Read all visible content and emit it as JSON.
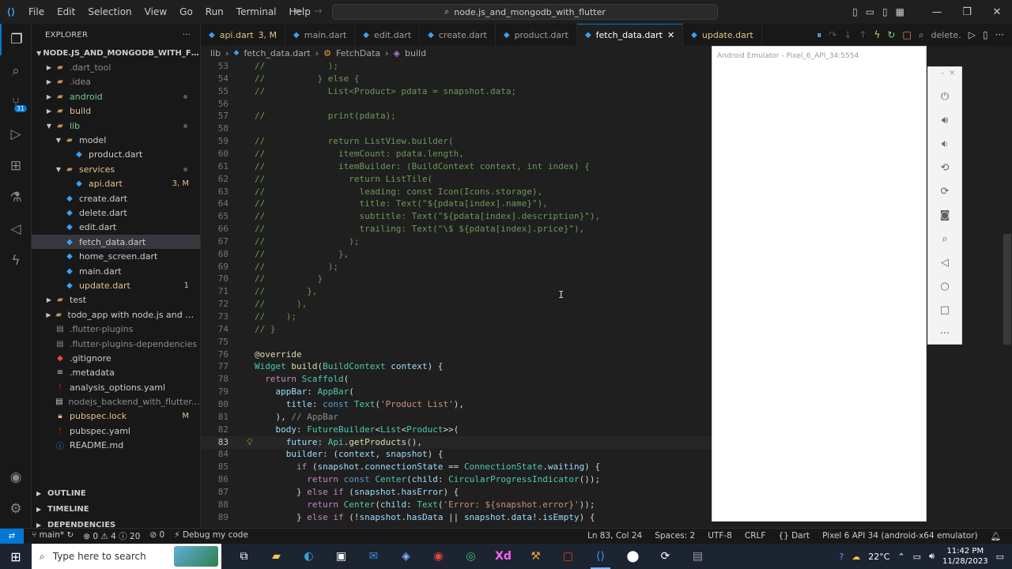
{
  "titlebar": {
    "menu": [
      "File",
      "Edit",
      "Selection",
      "View",
      "Go",
      "Run",
      "Terminal",
      "Help"
    ],
    "search": "node.js_and_mongodb_with_flutter"
  },
  "activity": {
    "source_control_badge": "31"
  },
  "sidebar": {
    "title": "EXPLORER",
    "root": "NODE.JS_AND_MONGODB_WITH_FLUTTER",
    "items": [
      {
        "label": ".dart_tool",
        "indent": 1,
        "kind": "folder",
        "open": false,
        "color": "#8b8b8b"
      },
      {
        "label": ".idea",
        "indent": 1,
        "kind": "folder",
        "open": false,
        "color": "#8b8b8b"
      },
      {
        "label": "android",
        "indent": 1,
        "kind": "folder",
        "open": false,
        "color": "#73c991",
        "dot": true
      },
      {
        "label": "build",
        "indent": 1,
        "kind": "folder",
        "open": false,
        "color": "#e2c08d"
      },
      {
        "label": "lib",
        "indent": 1,
        "kind": "folder",
        "open": true,
        "color": "#73c991",
        "dot": true
      },
      {
        "label": "model",
        "indent": 2,
        "kind": "folder",
        "open": true,
        "color": "#cccccc"
      },
      {
        "label": "product.dart",
        "indent": 3,
        "kind": "dart",
        "color": "#cccccc"
      },
      {
        "label": "services",
        "indent": 2,
        "kind": "folder",
        "open": true,
        "color": "#e2c08d",
        "dot": true
      },
      {
        "label": "api.dart",
        "indent": 3,
        "kind": "dart",
        "color": "#e2c08d",
        "badge": "3, M"
      },
      {
        "label": "create.dart",
        "indent": 2,
        "kind": "dart",
        "color": "#cccccc"
      },
      {
        "label": "delete.dart",
        "indent": 2,
        "kind": "dart",
        "color": "#cccccc"
      },
      {
        "label": "edit.dart",
        "indent": 2,
        "kind": "dart",
        "color": "#cccccc"
      },
      {
        "label": "fetch_data.dart",
        "indent": 2,
        "kind": "dart",
        "color": "#cccccc",
        "selected": true
      },
      {
        "label": "home_screen.dart",
        "indent": 2,
        "kind": "dart",
        "color": "#cccccc"
      },
      {
        "label": "main.dart",
        "indent": 2,
        "kind": "dart",
        "color": "#cccccc"
      },
      {
        "label": "update.dart",
        "indent": 2,
        "kind": "dart",
        "color": "#e2c08d",
        "badge": "1"
      },
      {
        "label": "test",
        "indent": 1,
        "kind": "folder",
        "open": false,
        "color": "#cccccc"
      },
      {
        "label": "todo_app with node.js and mon...",
        "indent": 1,
        "kind": "folder",
        "open": false,
        "color": "#cccccc"
      },
      {
        "label": ".flutter-plugins",
        "indent": 1,
        "kind": "file",
        "color": "#8b8b8b"
      },
      {
        "label": ".flutter-plugins-dependencies",
        "indent": 1,
        "kind": "file",
        "color": "#8b8b8b"
      },
      {
        "label": ".gitignore",
        "indent": 1,
        "kind": "git",
        "color": "#cccccc"
      },
      {
        "label": ".metadata",
        "indent": 1,
        "kind": "meta",
        "color": "#cccccc"
      },
      {
        "label": "analysis_options.yaml",
        "indent": 1,
        "kind": "yaml",
        "color": "#cccccc"
      },
      {
        "label": "nodejs_backend_with_flutter.iml",
        "indent": 1,
        "kind": "iml",
        "color": "#8b8b8b"
      },
      {
        "label": "pubspec.lock",
        "indent": 1,
        "kind": "lock",
        "color": "#e2c08d",
        "badge": "M"
      },
      {
        "label": "pubspec.yaml",
        "indent": 1,
        "kind": "yaml",
        "color": "#cccccc"
      },
      {
        "label": "README.md",
        "indent": 1,
        "kind": "info",
        "color": "#cccccc"
      }
    ],
    "sections": [
      "OUTLINE",
      "TIMELINE",
      "DEPENDENCIES"
    ]
  },
  "tabs": [
    {
      "label": "api.dart",
      "suffix": "3, M",
      "modified": true
    },
    {
      "label": "main.dart"
    },
    {
      "label": "edit.dart"
    },
    {
      "label": "create.dart"
    },
    {
      "label": "product.dart"
    },
    {
      "label": "fetch_data.dart",
      "active": true
    },
    {
      "label": "update.dart",
      "modified": true
    },
    {
      "label": "delete."
    }
  ],
  "breadcrumb": [
    "lib",
    "fetch_data.dart",
    "FetchData",
    "build"
  ],
  "code": [
    {
      "n": "53",
      "t": [
        [
          "c-com",
          "//            );"
        ]
      ]
    },
    {
      "n": "54",
      "t": [
        [
          "c-com",
          "//          } else {"
        ]
      ]
    },
    {
      "n": "55",
      "t": [
        [
          "c-com",
          "//            List<Product> pdata = snapshot.data;"
        ]
      ]
    },
    {
      "n": "56",
      "t": []
    },
    {
      "n": "57",
      "t": [
        [
          "c-com",
          "//            print(pdata);"
        ]
      ]
    },
    {
      "n": "58",
      "t": []
    },
    {
      "n": "59",
      "t": [
        [
          "c-com",
          "//            return ListView.builder("
        ]
      ]
    },
    {
      "n": "60",
      "t": [
        [
          "c-com",
          "//              itemCount: pdata.length,"
        ]
      ]
    },
    {
      "n": "61",
      "t": [
        [
          "c-com",
          "//              itemBuilder: (BuildContext context, int index) {"
        ]
      ]
    },
    {
      "n": "62",
      "t": [
        [
          "c-com",
          "//                return ListTile("
        ]
      ]
    },
    {
      "n": "63",
      "t": [
        [
          "c-com",
          "//                  leading: const Icon(Icons.storage),"
        ]
      ]
    },
    {
      "n": "64",
      "t": [
        [
          "c-com",
          "//                  title: Text(\"${pdata[index].name}\"),"
        ]
      ]
    },
    {
      "n": "65",
      "t": [
        [
          "c-com",
          "//                  subtitle: Text(\"${pdata[index].description}\"),"
        ]
      ]
    },
    {
      "n": "66",
      "t": [
        [
          "c-com",
          "//                  trailing: Text(\"\\$ ${pdata[index].price}\"),"
        ]
      ]
    },
    {
      "n": "67",
      "t": [
        [
          "c-com",
          "//                );"
        ]
      ]
    },
    {
      "n": "68",
      "t": [
        [
          "c-com",
          "//              },"
        ]
      ]
    },
    {
      "n": "69",
      "t": [
        [
          "c-com",
          "//            );"
        ]
      ]
    },
    {
      "n": "70",
      "t": [
        [
          "c-com",
          "//          }"
        ]
      ]
    },
    {
      "n": "71",
      "t": [
        [
          "c-com",
          "//        },"
        ]
      ]
    },
    {
      "n": "72",
      "t": [
        [
          "c-com",
          "//      ),"
        ]
      ]
    },
    {
      "n": "73",
      "t": [
        [
          "c-com",
          "//    );"
        ]
      ]
    },
    {
      "n": "74",
      "t": [
        [
          "c-com",
          "// }"
        ]
      ]
    },
    {
      "n": "75",
      "t": []
    },
    {
      "n": "76",
      "t": [
        [
          "c-ann",
          "@override"
        ]
      ]
    },
    {
      "n": "77",
      "t": [
        [
          "c-type",
          "Widget "
        ],
        [
          "c-fn",
          "build"
        ],
        [
          "",
          "("
        ],
        [
          "c-type",
          "BuildContext "
        ],
        [
          "c-var",
          "context"
        ],
        [
          "",
          ") {"
        ]
      ]
    },
    {
      "n": "78",
      "t": [
        [
          "",
          "  "
        ],
        [
          "c-kw2",
          "return "
        ],
        [
          "c-type",
          "Scaffold"
        ],
        [
          "",
          "("
        ]
      ]
    },
    {
      "n": "79",
      "t": [
        [
          "",
          "    "
        ],
        [
          "c-var",
          "appBar"
        ],
        [
          "",
          ": "
        ],
        [
          "c-type",
          "AppBar"
        ],
        [
          "",
          "("
        ]
      ]
    },
    {
      "n": "80",
      "t": [
        [
          "",
          "      "
        ],
        [
          "c-var",
          "title"
        ],
        [
          "",
          ": "
        ],
        [
          "c-kw",
          "const "
        ],
        [
          "c-type",
          "Text"
        ],
        [
          "",
          "("
        ],
        [
          "c-str",
          "'Product List'"
        ],
        [
          "",
          "),"
        ]
      ]
    },
    {
      "n": "81",
      "t": [
        [
          "",
          "    ), "
        ],
        [
          "c-hint",
          "// AppBar"
        ]
      ]
    },
    {
      "n": "82",
      "t": [
        [
          "",
          "    "
        ],
        [
          "c-var",
          "body"
        ],
        [
          "",
          ": "
        ],
        [
          "c-type",
          "FutureBuilder"
        ],
        [
          "",
          "<"
        ],
        [
          "c-type",
          "List"
        ],
        [
          "",
          "<"
        ],
        [
          "c-type",
          "Product"
        ],
        [
          "",
          ">>("
        ]
      ]
    },
    {
      "n": "83",
      "t": [
        [
          "",
          "      "
        ],
        [
          "c-var",
          "future"
        ],
        [
          "",
          ": "
        ],
        [
          "c-type",
          "Api"
        ],
        [
          "",
          "."
        ],
        [
          "c-fn",
          "getProducts"
        ],
        [
          "",
          "(),"
        ]
      ],
      "current": true
    },
    {
      "n": "84",
      "t": [
        [
          "",
          "      "
        ],
        [
          "c-var",
          "builder"
        ],
        [
          "",
          ": ("
        ],
        [
          "c-var",
          "context"
        ],
        [
          "",
          ", "
        ],
        [
          "c-var",
          "snapshot"
        ],
        [
          "",
          ") {"
        ]
      ]
    },
    {
      "n": "85",
      "t": [
        [
          "",
          "        "
        ],
        [
          "c-kw2",
          "if "
        ],
        [
          "",
          "("
        ],
        [
          "c-var",
          "snapshot"
        ],
        [
          "",
          "."
        ],
        [
          "c-var",
          "connectionState"
        ],
        [
          "",
          " == "
        ],
        [
          "c-type",
          "ConnectionState"
        ],
        [
          "",
          "."
        ],
        [
          "c-var",
          "waiting"
        ],
        [
          "",
          ") {"
        ]
      ]
    },
    {
      "n": "86",
      "t": [
        [
          "",
          "          "
        ],
        [
          "c-kw2",
          "return "
        ],
        [
          "c-kw",
          "const "
        ],
        [
          "c-type",
          "Center"
        ],
        [
          "",
          "("
        ],
        [
          "c-var",
          "child"
        ],
        [
          "",
          ": "
        ],
        [
          "c-type",
          "CircularProgressIndicator"
        ],
        [
          "",
          "());"
        ]
      ]
    },
    {
      "n": "87",
      "t": [
        [
          "",
          "        } "
        ],
        [
          "c-kw2",
          "else if "
        ],
        [
          "",
          "("
        ],
        [
          "c-var",
          "snapshot"
        ],
        [
          "",
          "."
        ],
        [
          "c-var",
          "hasError"
        ],
        [
          "",
          ") {"
        ]
      ]
    },
    {
      "n": "88",
      "t": [
        [
          "",
          "          "
        ],
        [
          "c-kw2",
          "return "
        ],
        [
          "c-type",
          "Center"
        ],
        [
          "",
          "("
        ],
        [
          "c-var",
          "child"
        ],
        [
          "",
          ": "
        ],
        [
          "c-type",
          "Text"
        ],
        [
          "",
          "("
        ],
        [
          "c-str",
          "'Error: ${snapshot.error}'"
        ],
        [
          "",
          "));"
        ]
      ]
    },
    {
      "n": "89",
      "t": [
        [
          "",
          "        } "
        ],
        [
          "c-kw2",
          "else if "
        ],
        [
          "",
          "(!"
        ],
        [
          "c-var",
          "snapshot"
        ],
        [
          "",
          "."
        ],
        [
          "c-var",
          "hasData"
        ],
        [
          "",
          " || "
        ],
        [
          "c-var",
          "snapshot"
        ],
        [
          "",
          "."
        ],
        [
          "c-var",
          "data"
        ],
        [
          "",
          "!."
        ],
        [
          "c-var",
          "isEmpty"
        ],
        [
          "",
          ") {"
        ]
      ]
    }
  ],
  "emulator": {
    "title": "Android Emulator - Pixel_6_API_34:5554"
  },
  "status": {
    "branch": "main*",
    "problems": "⊗ 0 ⚠ 4 ⓘ 20",
    "ports": "0",
    "debug": "Debug my code",
    "position": "Ln 83, Col 24",
    "spaces": "Spaces: 2",
    "encoding": "UTF-8",
    "eol": "CRLF",
    "language": "Dart",
    "device": "Pixel 6 API 34 (android-x64 emulator)"
  },
  "taskbar": {
    "search_placeholder": "Type here to search",
    "weather": "22°C",
    "time": "11:42 PM",
    "date": "11/28/2023"
  }
}
